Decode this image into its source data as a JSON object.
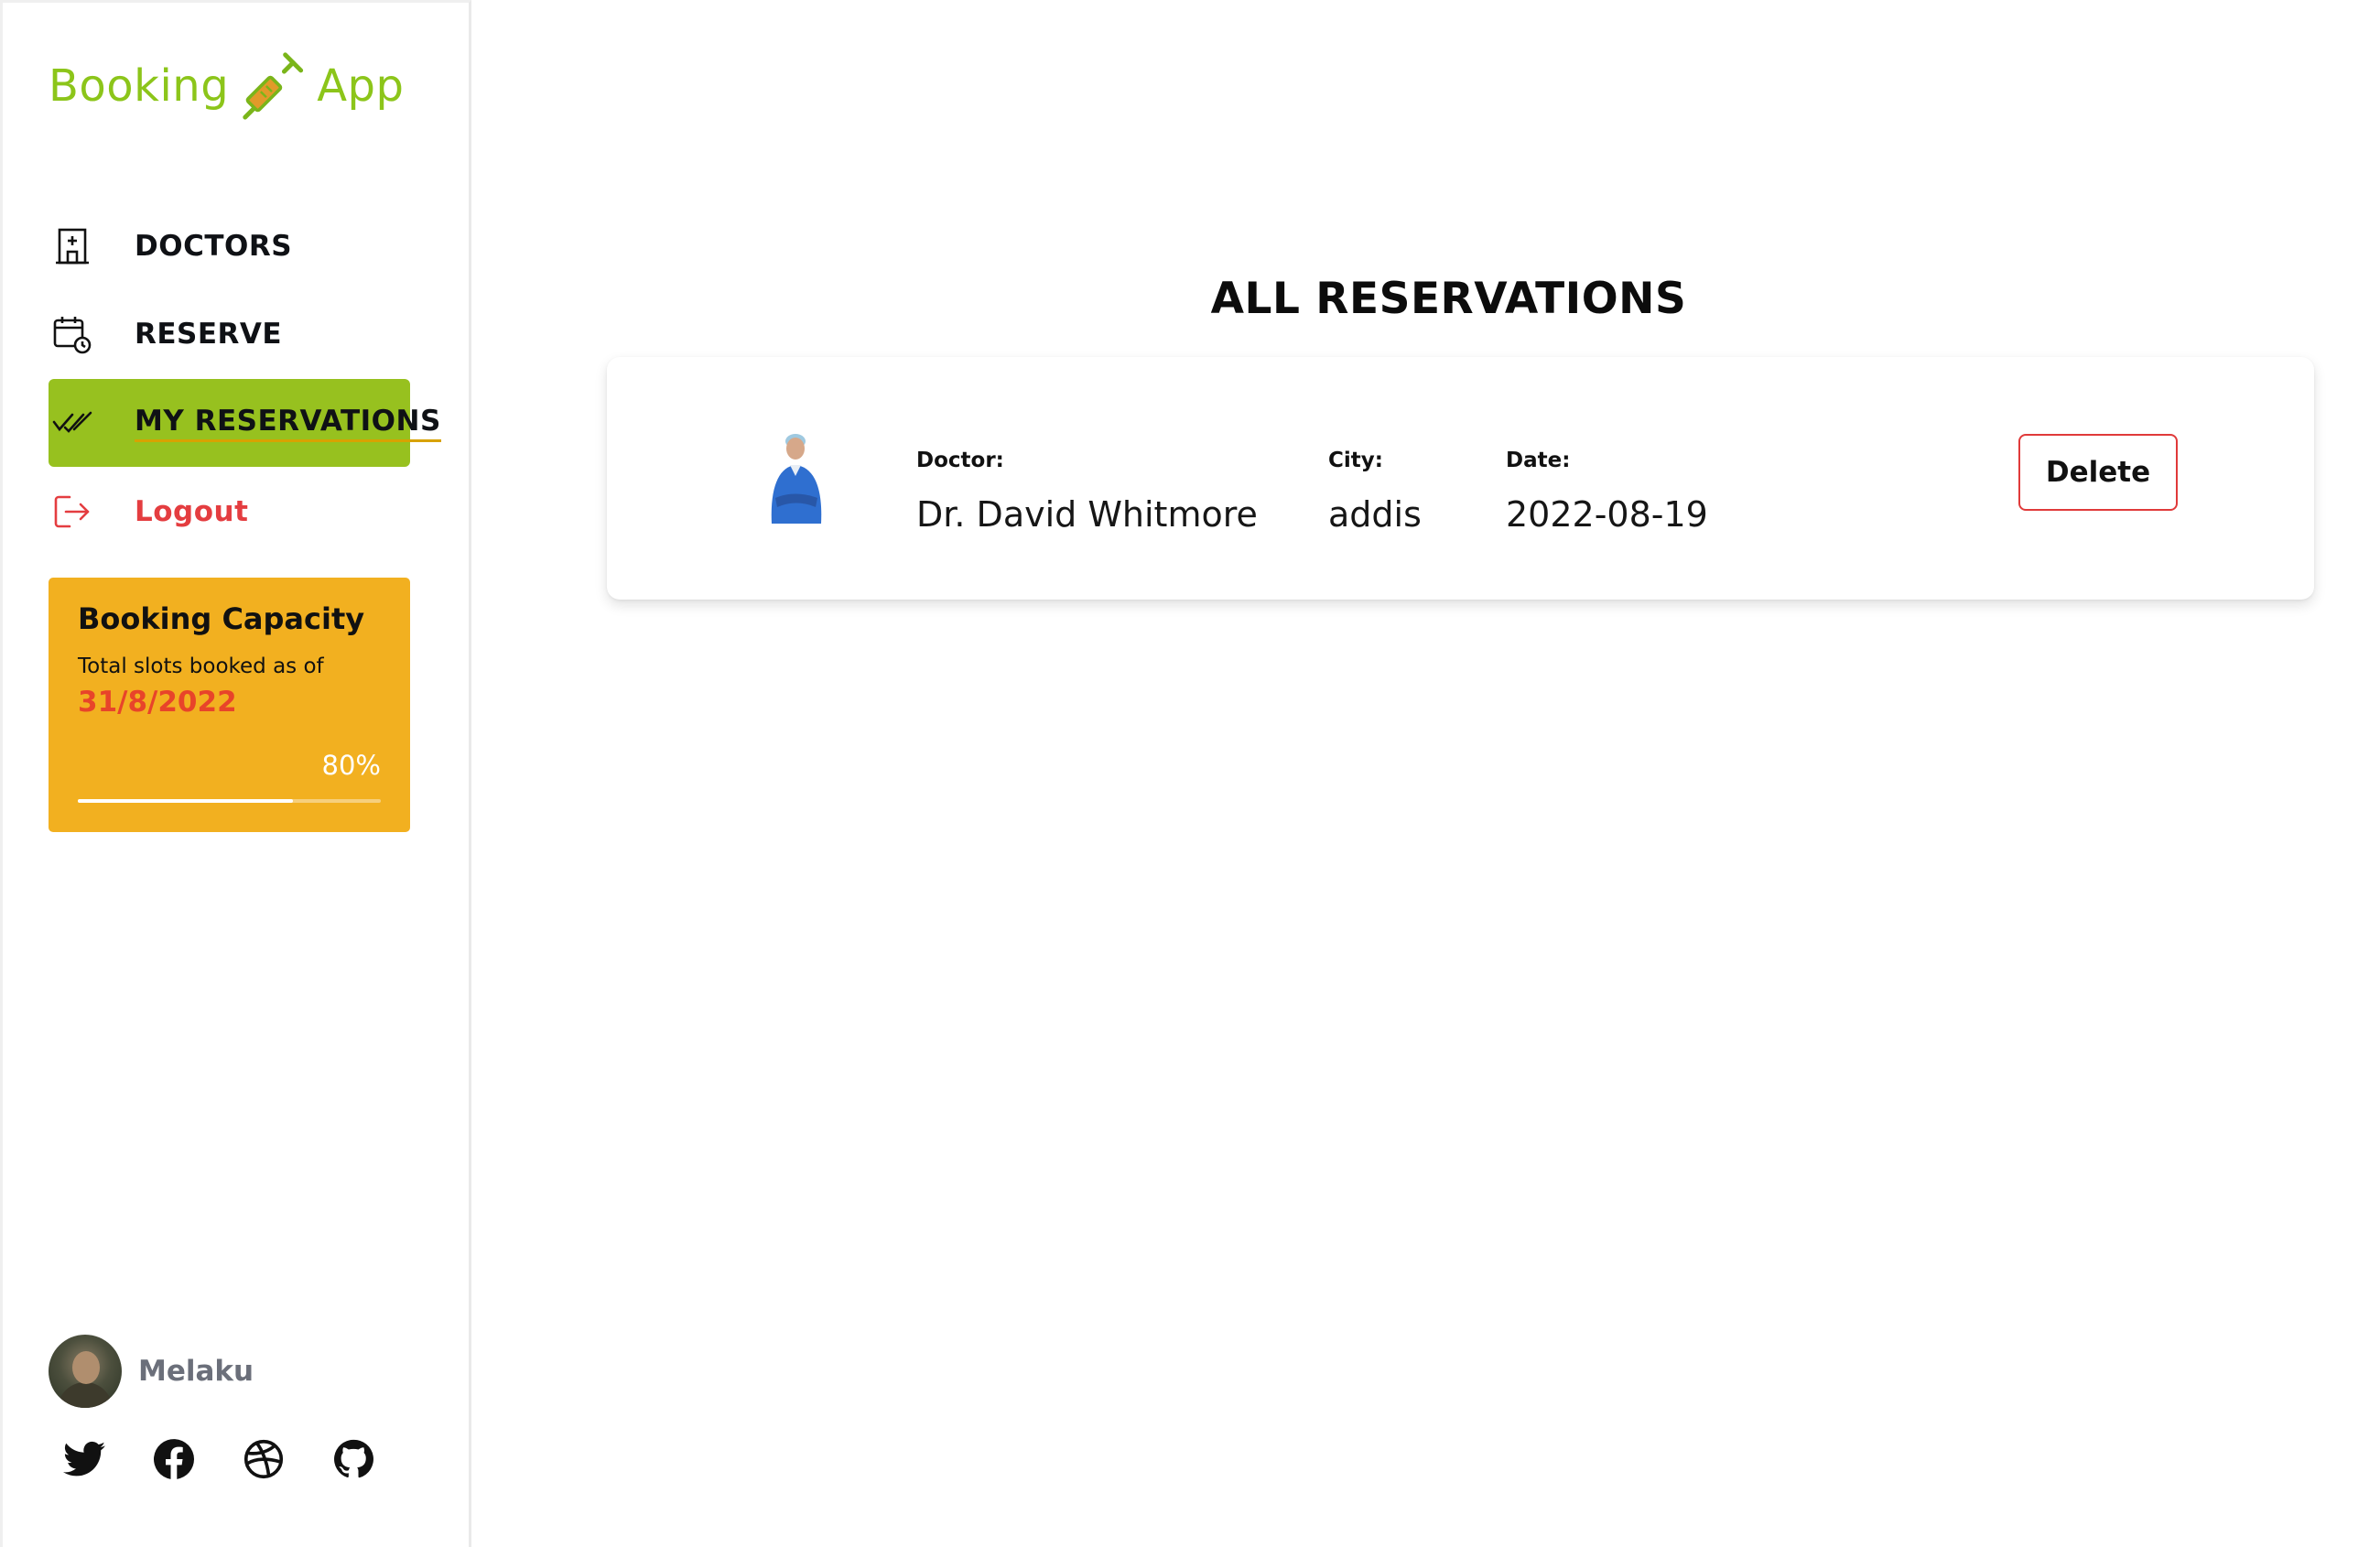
{
  "brand": {
    "left": "Booking",
    "right": "App",
    "icon": "syringe-icon",
    "color": "#8cc51a"
  },
  "nav": {
    "items": [
      {
        "label": "DOCTORS",
        "icon": "hospital-icon",
        "active": false
      },
      {
        "label": "RESERVE",
        "icon": "calendar-clock-icon",
        "active": false
      },
      {
        "label": "MY RESERVATIONS",
        "icon": "double-check-icon",
        "active": true
      },
      {
        "label": "Logout",
        "icon": "logout-icon",
        "active": false
      }
    ],
    "active_color": "#97c11f",
    "logout_color": "#e43d40"
  },
  "capacity": {
    "title": "Booking Capacity",
    "subtitle": "Total slots booked as of",
    "date": "31/8/2022",
    "percent_label": "80%",
    "progress": 0.71,
    "background": "#f2b020"
  },
  "user": {
    "name": "Melaku",
    "avatar": "avatar"
  },
  "socials": [
    "twitter-icon",
    "facebook-icon",
    "dribbble-icon",
    "github-icon"
  ],
  "main": {
    "title": "ALL RESERVATIONS",
    "reservations": [
      {
        "doctor_label": "Doctor:",
        "doctor": "Dr. David Whitmore",
        "city_label": "City:",
        "city": "addis",
        "date_label": "Date:",
        "date": "2022-08-19",
        "delete_label": "Delete"
      }
    ]
  }
}
